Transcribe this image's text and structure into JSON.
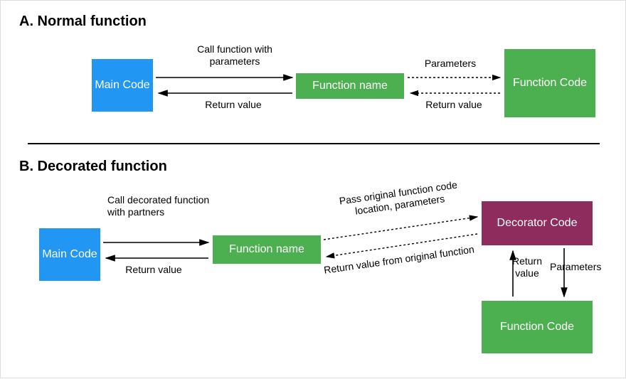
{
  "sectionA": {
    "title": "A. Normal function",
    "main": "Main Code",
    "fn": "Function name",
    "code": "Function Code",
    "call": "Call function with parameters",
    "ret": "Return value",
    "params": "Parameters",
    "ret2": "Return value"
  },
  "sectionB": {
    "title": "B. Decorated function",
    "main": "Main Code",
    "fn": "Function name",
    "decorator": "Decorator Code",
    "code": "Function Code",
    "call": "Call decorated function with partners",
    "ret": "Return value",
    "pass": "Pass original function code location, parameters",
    "retOrig": "Return value from original function",
    "retVal": "Return value",
    "paramsDown": "Parameters"
  },
  "colors": {
    "blue": "#2196f3",
    "green": "#4caf50",
    "purple": "#8e2c5e"
  }
}
